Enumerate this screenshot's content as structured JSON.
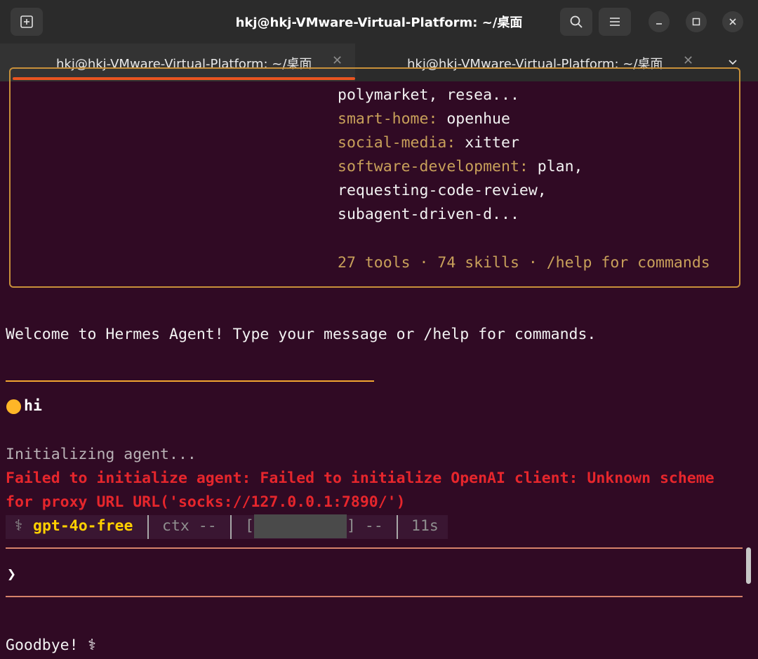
{
  "window": {
    "title": "hkj@hkj-VMware-Virtual-Platform: ~/桌面"
  },
  "tabs": [
    {
      "label": "hkj@hkj-VMware-Virtual-Platform: ~/桌面",
      "active": true
    },
    {
      "label": "hkj@hkj-VMware-Virtual-Platform: ~/桌面",
      "active": false
    }
  ],
  "icons": {
    "new_tab": "new-tab-icon",
    "search": "search-icon",
    "menu": "hamburger-menu-icon",
    "minimize": "minimize-icon",
    "maximize": "maximize-icon",
    "close": "close-icon",
    "tab_close": "tab-close-icon",
    "tab_dropdown": "chevron-down-icon"
  },
  "banner": {
    "line1": "polymarket, resea...",
    "smart_home_key": "smart-home:",
    "smart_home_val": " openhue",
    "social_media_key": "social-media:",
    "social_media_val": " xitter",
    "software_dev_key": "software-development:",
    "software_dev_val": " plan,",
    "line_review": "requesting-code-review,",
    "line_subagent": "subagent-driven-d...",
    "summary": "27 tools · 74 skills · /help for commands"
  },
  "welcome": "Welcome to Hermes Agent! Type your message or /help for commands.",
  "user_message": "hi",
  "initializing": "Initializing agent...",
  "error_line1": "Failed to initialize agent: Failed to initialize OpenAI client: Unknown scheme",
  "error_line2": "for proxy URL URL('socks://127.0.0.1:7890/')",
  "status": {
    "glyph": "⚕",
    "model": "gpt-4o-free",
    "ctx": "ctx --",
    "bracket_open": "[",
    "bracket_close": "] --",
    "time": "11s"
  },
  "prompt_glyph": "❯",
  "goodbye": "Goodbye! ⚕",
  "colors": {
    "terminal_bg": "#300a24",
    "accent_orange": "#e95420",
    "gold": "#c8a05a",
    "error_red": "#e6262c",
    "model_yellow": "#ffd000"
  }
}
